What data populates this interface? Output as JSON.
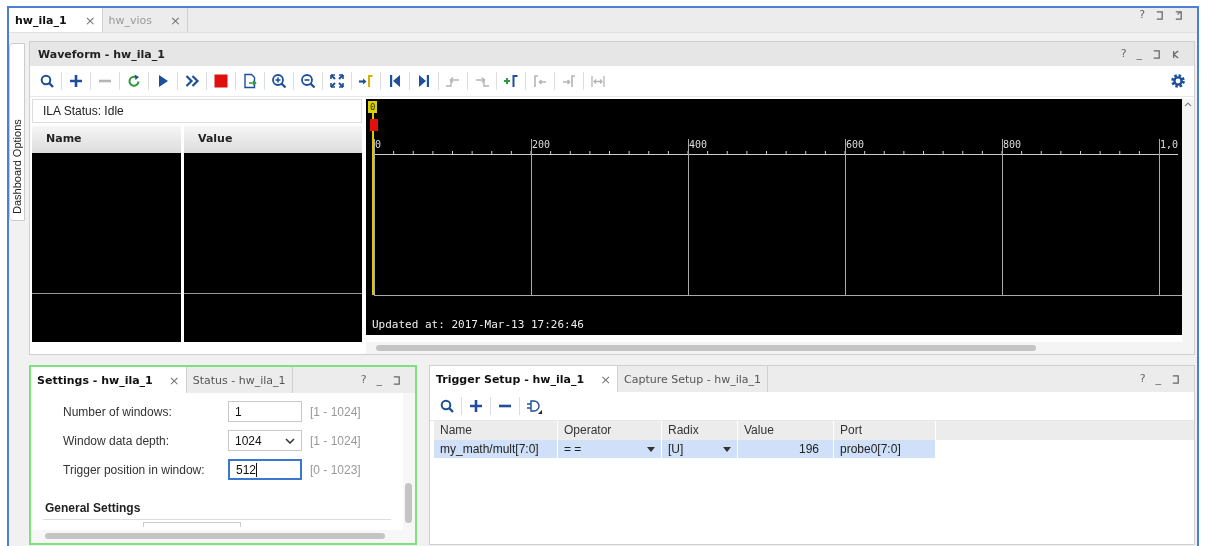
{
  "tabs": [
    {
      "label": "hw_ila_1",
      "close": "×",
      "selected": true
    },
    {
      "label": "hw_vios",
      "close": "×",
      "selected": false
    }
  ],
  "window_controls": [
    {
      "kind": "help",
      "glyph": "?"
    },
    {
      "kind": "restore"
    },
    {
      "kind": "float"
    }
  ],
  "side_tab": {
    "label": "Dashboard Options"
  },
  "waveform": {
    "title": "Waveform - hw_ila_1",
    "controls": [
      {
        "kind": "help",
        "glyph": "?"
      },
      {
        "kind": "minimize",
        "glyph": "_"
      },
      {
        "kind": "restore"
      },
      {
        "kind": "collapse"
      }
    ],
    "toolbar": [
      {
        "kind": "search",
        "disabled": false
      },
      {
        "kind": "add",
        "disabled": false
      },
      {
        "kind": "remove",
        "disabled": true
      },
      {
        "kind": "refresh",
        "disabled": false
      },
      {
        "kind": "run",
        "disabled": false
      },
      {
        "kind": "run-fast",
        "disabled": false
      },
      {
        "kind": "stop",
        "disabled": false
      },
      {
        "kind": "export",
        "disabled": false
      },
      {
        "kind": "zoom-in",
        "disabled": false
      },
      {
        "kind": "zoom-out",
        "disabled": false
      },
      {
        "kind": "zoom-fit",
        "disabled": false
      },
      {
        "kind": "goto-cursor",
        "disabled": false
      },
      {
        "kind": "first",
        "disabled": false
      },
      {
        "kind": "last",
        "disabled": false
      },
      {
        "kind": "marker-prev",
        "disabled": true
      },
      {
        "kind": "marker-next",
        "disabled": true
      },
      {
        "kind": "marker-add",
        "disabled": false
      },
      {
        "kind": "bracket-left",
        "disabled": true
      },
      {
        "kind": "bracket-right",
        "disabled": true
      },
      {
        "kind": "span",
        "disabled": true
      }
    ],
    "status": "ILA Status: Idle",
    "columns": [
      "Name",
      "Value"
    ],
    "cursor_label": "0",
    "ruler_labels": [
      "0",
      "200",
      "400",
      "600",
      "800",
      "1,0"
    ],
    "updated": "Updated at: 2017-Mar-13 17:26:46"
  },
  "settings": {
    "tabs": [
      {
        "label": "Settings - hw_ila_1",
        "close": "×",
        "selected": true
      },
      {
        "label": "Status - hw_ila_1",
        "selected": false
      }
    ],
    "controls": [
      {
        "kind": "help",
        "glyph": "?"
      },
      {
        "kind": "minimize",
        "glyph": "_"
      },
      {
        "kind": "restore"
      }
    ],
    "rows": [
      {
        "label": "Number of windows:",
        "kind": "text",
        "value": "1",
        "range": "[1 - 1024]",
        "focused": false
      },
      {
        "label": "Window data depth:",
        "kind": "select",
        "value": "1024",
        "range": "[1 - 1024]",
        "focused": false
      },
      {
        "label": "Trigger position in window:",
        "kind": "text",
        "value": "512",
        "range": "[0 - 1023]",
        "focused": true
      }
    ],
    "section": "General Settings"
  },
  "trigger": {
    "tabs": [
      {
        "label": "Trigger Setup - hw_ila_1",
        "close": "×",
        "selected": true
      },
      {
        "label": "Capture Setup - hw_ila_1",
        "selected": false
      }
    ],
    "controls": [
      {
        "kind": "help",
        "glyph": "?"
      },
      {
        "kind": "minimize",
        "glyph": "_"
      },
      {
        "kind": "restore"
      }
    ],
    "toolbar": [
      {
        "kind": "search",
        "disabled": false
      },
      {
        "kind": "add",
        "disabled": false
      },
      {
        "kind": "remove",
        "disabled": false
      },
      {
        "kind": "gate",
        "disabled": false
      }
    ],
    "columns": [
      "Name",
      "Operator",
      "Radix",
      "Value",
      "Port"
    ],
    "rows": [
      {
        "selected": true,
        "cells": [
          {
            "kind": "text",
            "text": "my_math/mult[7:0]"
          },
          {
            "kind": "dropdown",
            "text": "= ="
          },
          {
            "kind": "dropdown",
            "text": "[U]"
          },
          {
            "kind": "number",
            "text": "196"
          },
          {
            "kind": "text",
            "text": "probe0[7:0]"
          }
        ]
      }
    ]
  }
}
